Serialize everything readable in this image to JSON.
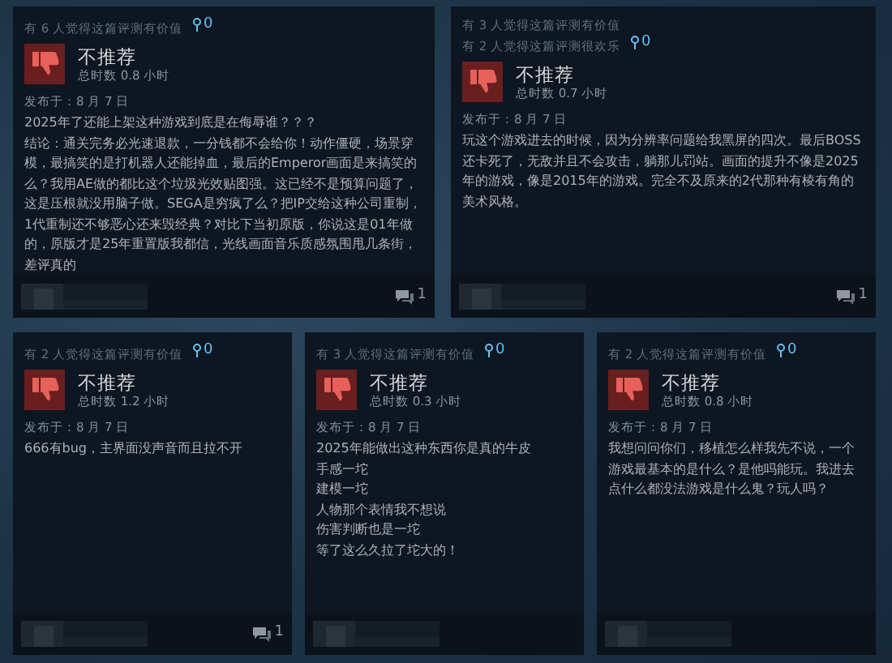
{
  "reviews": [
    {
      "helpful": [
        "有 6 人觉得这篇评测有价值"
      ],
      "awards": "0",
      "recommended": false,
      "verdict": "不推荐",
      "playtime": "总时数 0.8 小时",
      "posted": "发布于：8 月 7 日",
      "paragraphs": [
        "2025年了还能上架这种游戏到底是在侮辱谁？？？",
        "结论：通关完务必光速退款，一分钱都不会给你！动作僵硬，场景穿模，最搞笑的是打机器人还能掉血，最后的Emperor画面是来搞笑的么？我用AE做的都比这个垃圾光效贴图强。这已经不是预算问题了，这是压根就没用脑子做。SEGA是穷疯了么？把IP交给这种公司重制，1代重制还不够恶心还来毁经典？对比下当初原版，你说这是01年做的，原版才是25年重置版我都信，光线画面音乐质感氛围甩几条街，差评真的"
      ],
      "comments": "1"
    },
    {
      "helpful": [
        "有 3 人觉得这篇评测有价值",
        "有 2 人觉得这篇评测很欢乐"
      ],
      "awards": "0",
      "recommended": false,
      "verdict": "不推荐",
      "playtime": "总时数 0.7 小时",
      "posted": "发布于：8 月 7 日",
      "paragraphs": [
        "玩这个游戏进去的时候，因为分辨率问题给我黑屏的四次。最后BOSS还卡死了，无敌并且不会攻击，躺那儿罚站。画面的提升不像是2025年的游戏，像是2015年的游戏。完全不及原来的2代那种有棱有角的美术风格。"
      ],
      "comments": "1"
    },
    {
      "helpful": [
        "有 2 人觉得这篇评测有价值"
      ],
      "awards": "0",
      "recommended": false,
      "verdict": "不推荐",
      "playtime": "总时数 1.2 小时",
      "posted": "发布于：8 月 7 日",
      "paragraphs": [
        "666有bug，主界面没声音而且拉不开"
      ],
      "comments": "1"
    },
    {
      "helpful": [
        "有 3 人觉得这篇评测有价值"
      ],
      "awards": "0",
      "recommended": false,
      "verdict": "不推荐",
      "playtime": "总时数 0.3 小时",
      "posted": "发布于：8 月 7 日",
      "paragraphs": [
        "2025年能做出这种东西你是真的牛皮",
        "手感一坨",
        "建模一坨",
        "人物那个表情我不想说",
        "伤害判断也是一坨",
        "等了这么久拉了坨大的！"
      ]
    },
    {
      "helpful": [
        "有 2 人觉得这篇评测有价值"
      ],
      "awards": "0",
      "recommended": false,
      "verdict": "不推荐",
      "playtime": "总时数 0.8 小时",
      "posted": "发布于：8 月 7 日",
      "paragraphs": [
        "我想问问你们，移植怎么样我先不说，一个游戏最基本的是什么？是他吗能玩。我进去点什么都没法游戏是什么鬼？玩人吗？"
      ]
    }
  ]
}
